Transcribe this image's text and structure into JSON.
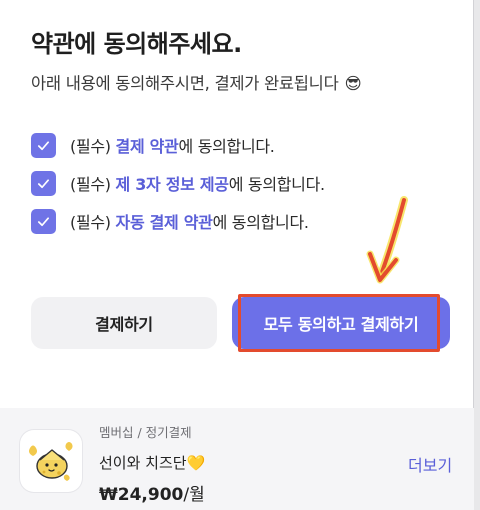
{
  "dialog": {
    "title": "약관에 동의해주세요.",
    "subtitle": "아래 내용에 동의해주시면, 결제가 완료됩니다",
    "subtitle_emoji": "😎"
  },
  "agreements": [
    {
      "checked": true,
      "prefix": "(필수)",
      "link": "결제 약관",
      "suffix": "에 동의합니다."
    },
    {
      "checked": true,
      "prefix": "(필수)",
      "link": "제 3자 정보 제공",
      "suffix": "에 동의합니다."
    },
    {
      "checked": true,
      "prefix": "(필수)",
      "link": "자동 결제 약관",
      "suffix": "에 동의합니다."
    }
  ],
  "buttons": {
    "pay": "결제하기",
    "agree_all_pay": "모두 동의하고 결제하기"
  },
  "product": {
    "category": "멤버십 / 정기결제",
    "name": "선이와 치즈단💛",
    "price": "₩24,900",
    "per": "/월",
    "more": "더보기"
  },
  "colors": {
    "accent": "#6c70e8",
    "highlight": "#e34b2e",
    "arrow": "#e34b2e"
  }
}
